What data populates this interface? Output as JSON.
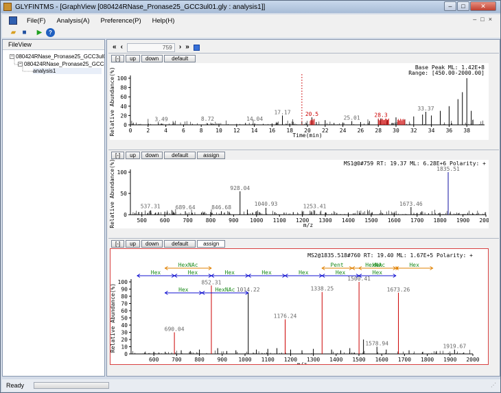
{
  "window": {
    "title": "GLYFINTMS - [GraphView [080424RNase_Pronase25_GCC3ul01.gly : analysis1]]"
  },
  "menu": {
    "items": [
      "File(F)",
      "Analysis(A)",
      "Preference(P)",
      "Help(H)"
    ]
  },
  "toolbar": {
    "icons": [
      "open-folder-icon",
      "save-disk-icon",
      "run-play-icon",
      "help-icon"
    ]
  },
  "fileview": {
    "header": "FileView",
    "tree": [
      "080424RNase_Pronase25_GCC3ul01",
      "080424RNase_Pronase25_GCC3",
      "analysis1"
    ]
  },
  "navigator": {
    "scan": "759"
  },
  "panel_buttons": {
    "collapse": "[-]",
    "up": "up",
    "down": "down",
    "default": "default",
    "assign": "assign"
  },
  "status": {
    "text": "Ready"
  },
  "colors": {
    "chrome": "#d4dce8",
    "plot_black": "#000000",
    "red_peak": "#cc0000",
    "green_label": "#1a8a1a",
    "orange_label": "#e08000",
    "blue_arrow": "#1010d0",
    "selection_border": "#d84040"
  },
  "chart_data": [
    {
      "type": "line",
      "title": "",
      "info_lines": [
        "Base Peak ML: 1.42E+8",
        "Range: [450.00-2000.00]"
      ],
      "xlabel": "Time(min)",
      "ylabel": "Relative Abundance(%)",
      "xlim": [
        0,
        40
      ],
      "ylim": [
        0,
        100
      ],
      "xticks": [
        0,
        2,
        4,
        6,
        8,
        10,
        12,
        14,
        16,
        18,
        20,
        22,
        24,
        26,
        28,
        30,
        32,
        34,
        36,
        38
      ],
      "yticks": [
        0,
        20,
        40,
        60,
        80,
        100
      ],
      "marker_x": 19.37,
      "peak_labels": [
        {
          "x": 3.49,
          "y": 5,
          "text": "3.49"
        },
        {
          "x": 8.72,
          "y": 6,
          "text": "8.72"
        },
        {
          "x": 14.04,
          "y": 6,
          "text": "14.04"
        },
        {
          "x": 17.17,
          "y": 20,
          "text": "17.17"
        },
        {
          "x": 20.5,
          "y": 16,
          "text": "20.5",
          "color": "red"
        },
        {
          "x": 25.01,
          "y": 8,
          "text": "25.01"
        },
        {
          "x": 28.3,
          "y": 14,
          "text": "28.3",
          "color": "red"
        },
        {
          "x": 33.37,
          "y": 28,
          "text": "33.37"
        }
      ],
      "x": [
        1,
        2,
        3.49,
        5,
        6,
        7,
        8.72,
        10,
        11,
        12,
        13,
        14.04,
        15,
        16,
        17.17,
        18,
        19.37,
        20.5,
        21,
        22,
        23,
        24,
        25.01,
        26,
        27,
        28,
        28.3,
        29,
        30,
        31,
        32,
        33,
        33.37,
        34,
        35,
        36,
        37,
        37.5,
        38,
        38.5
      ],
      "y": [
        1,
        1,
        3,
        1,
        1,
        2,
        3,
        1,
        1,
        2,
        4,
        3,
        2,
        3,
        20,
        3,
        6,
        16,
        6,
        10,
        4,
        5,
        8,
        6,
        8,
        12,
        14,
        10,
        16,
        12,
        18,
        22,
        28,
        20,
        30,
        40,
        55,
        70,
        100,
        30
      ]
    },
    {
      "type": "bar",
      "title": "",
      "info_lines": [
        "MS1@0#759 RT: 19.37 ML: 6.28E+6 Polarity: +"
      ],
      "xlabel": "m/z",
      "ylabel": "Relative Abundance(%)",
      "xlim": [
        450,
        2000
      ],
      "ylim": [
        0,
        100
      ],
      "xticks": [
        500,
        600,
        700,
        800,
        900,
        1000,
        1100,
        1200,
        1300,
        1400,
        1500,
        1600,
        1700,
        1800,
        1900,
        2000
      ],
      "yticks": [
        0,
        50,
        100
      ],
      "peak_labels": [
        {
          "x": 537.31,
          "y": 12,
          "text": "537.31"
        },
        {
          "x": 689.64,
          "y": 10,
          "text": "689.64"
        },
        {
          "x": 846.68,
          "y": 10,
          "text": "846.68"
        },
        {
          "x": 928.04,
          "y": 55,
          "text": "928.04"
        },
        {
          "x": 1040.93,
          "y": 18,
          "text": "1040.93"
        },
        {
          "x": 1253.41,
          "y": 12,
          "text": "1253.41"
        },
        {
          "x": 1673.46,
          "y": 18,
          "text": "1673.46"
        },
        {
          "x": 1835.51,
          "y": 100,
          "text": "1835.51"
        }
      ],
      "x": [
        470,
        500,
        537.31,
        560,
        600,
        640,
        689.64,
        720,
        760,
        800,
        846.68,
        880,
        928.04,
        960,
        1000,
        1040.93,
        1080,
        1120,
        1160,
        1200,
        1253.41,
        1300,
        1350,
        1400,
        1450,
        1500,
        1550,
        1600,
        1673.46,
        1700,
        1750,
        1800,
        1835.51,
        1880,
        1920,
        1960
      ],
      "y": [
        4,
        6,
        10,
        5,
        7,
        5,
        8,
        4,
        5,
        6,
        8,
        7,
        55,
        12,
        8,
        16,
        6,
        5,
        6,
        7,
        10,
        5,
        4,
        5,
        4,
        4,
        3,
        4,
        18,
        4,
        3,
        4,
        100,
        3,
        2,
        2
      ]
    },
    {
      "type": "bar",
      "title": "",
      "info_lines": [
        "MS2@1835.518#760 RT: 19.40 ML: 1.67E+5 Polarity: +"
      ],
      "xlabel": "m/z",
      "ylabel": "Relative Abundance(%)",
      "xlim": [
        500,
        2000
      ],
      "ylim": [
        0,
        100
      ],
      "xticks": [
        600,
        700,
        800,
        900,
        1000,
        1100,
        1200,
        1300,
        1400,
        1500,
        1600,
        1700,
        1800,
        1900,
        2000
      ],
      "yticks": [
        0,
        10,
        20,
        30,
        40,
        50,
        60,
        70,
        80,
        90,
        100
      ],
      "peak_labels": [
        {
          "x": 690.04,
          "y": 30,
          "text": "690.04"
        },
        {
          "x": 852.31,
          "y": 95,
          "text": "852.31"
        },
        {
          "x": 1014.22,
          "y": 85,
          "text": "1014.22"
        },
        {
          "x": 1176.24,
          "y": 48,
          "text": "1176.24"
        },
        {
          "x": 1338.25,
          "y": 86,
          "text": "1338.25"
        },
        {
          "x": 1500.41,
          "y": 100,
          "text": "1500.41"
        },
        {
          "x": 1578.94,
          "y": 10,
          "text": "1578.94"
        },
        {
          "x": 1673.26,
          "y": 85,
          "text": "1673.26"
        },
        {
          "x": 1919.67,
          "y": 6,
          "text": "1919.67"
        }
      ],
      "annotations": [
        {
          "label": "HexNAc",
          "from": 649,
          "to": 852,
          "row": 0,
          "color": "orange"
        },
        {
          "label": "Pent",
          "from": 1338,
          "to": 1470,
          "row": 0,
          "color": "orange"
        },
        {
          "label": "HexNAc",
          "from": 1470,
          "to": 1673,
          "row": 0,
          "color": "orange"
        },
        {
          "label": "Hex",
          "from": 1500,
          "to": 1662,
          "row": 0,
          "color": "orange"
        },
        {
          "label": "Hex",
          "from": 1662,
          "to": 1824,
          "row": 0,
          "color": "orange"
        },
        {
          "label": "Hex",
          "from": 527,
          "to": 690,
          "row": 1,
          "color": "blue"
        },
        {
          "label": "Hex",
          "from": 690,
          "to": 852,
          "row": 1,
          "color": "blue"
        },
        {
          "label": "Hex",
          "from": 852,
          "to": 1014,
          "row": 1,
          "color": "blue"
        },
        {
          "label": "Hex",
          "from": 1014,
          "to": 1176,
          "row": 1,
          "color": "blue"
        },
        {
          "label": "Hex",
          "from": 1176,
          "to": 1338,
          "row": 1,
          "color": "blue"
        },
        {
          "label": "Hex",
          "from": 1338,
          "to": 1500,
          "row": 1,
          "color": "blue"
        },
        {
          "label": "Hex",
          "from": 1500,
          "to": 1662,
          "row": 1,
          "color": "blue"
        },
        {
          "label": "Hex",
          "from": 649,
          "to": 811,
          "row": 2,
          "color": "blue"
        },
        {
          "label": "HexNAc",
          "from": 811,
          "to": 1014,
          "row": 2,
          "color": "blue"
        }
      ],
      "x": [
        560,
        600,
        650,
        690.04,
        720,
        760,
        800,
        852.31,
        880,
        920,
        960,
        1014.22,
        1050,
        1100,
        1140,
        1176.24,
        1200,
        1250,
        1300,
        1338.25,
        1380,
        1420,
        1460,
        1500.41,
        1520,
        1578.94,
        1620,
        1673.26,
        1720,
        1780,
        1840,
        1919.67,
        1960
      ],
      "y": [
        2,
        3,
        3,
        30,
        5,
        4,
        6,
        95,
        8,
        4,
        5,
        85,
        6,
        7,
        8,
        48,
        6,
        5,
        7,
        86,
        6,
        5,
        8,
        100,
        20,
        10,
        6,
        85,
        5,
        3,
        4,
        6,
        2
      ],
      "red_peaks": [
        690.04,
        852.31,
        1176.24,
        1338.25,
        1500.41,
        1673.26
      ]
    }
  ]
}
